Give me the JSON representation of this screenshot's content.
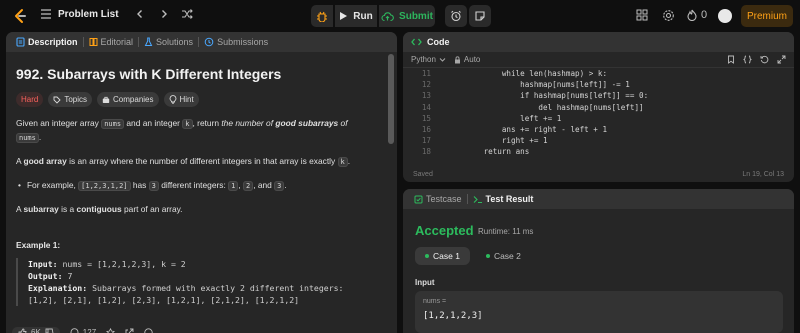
{
  "topbar": {
    "problem_list": "Problem List",
    "run": "Run",
    "submit": "Submit",
    "streak_count": "0",
    "premium": "Premium"
  },
  "left": {
    "tabs": [
      "Description",
      "Editorial",
      "Solutions",
      "Submissions"
    ],
    "title": "992. Subarrays with K Different Integers",
    "tags": [
      "Hard",
      "Topics",
      "Companies",
      "Hint"
    ],
    "desc1_a": "Given an integer array ",
    "desc1_nums": "nums",
    "desc1_b": " and an integer ",
    "desc1_k": "k",
    "desc1_c": ", return ",
    "desc1_d": "the number of ",
    "desc1_e": "good subarrays",
    "desc1_f": " of",
    "desc1_nums2": "nums",
    "desc1_g": ".",
    "desc2_a": "A ",
    "desc2_b": "good array",
    "desc2_c": " is an array where the number of different integers in that array is exactly ",
    "desc2_k": "k",
    "desc2_d": ".",
    "bullet_a": "For example, ",
    "bullet_code": "[1,2,3,1,2]",
    "bullet_b": " has ",
    "bullet_3": "3",
    "bullet_c": " different integers: ",
    "bullet_1": "1",
    "bullet_d": ", ",
    "bullet_2": "2",
    "bullet_e": ", and ",
    "bullet_3b": "3",
    "bullet_f": ".",
    "desc3_a": "A ",
    "desc3_b": "subarray",
    "desc3_c": " is a ",
    "desc3_d": "contiguous",
    "desc3_e": " part of an array.",
    "example_title": "Example 1:",
    "ex_input_label": "Input:",
    "ex_input": " nums = [1,2,1,2,3], k = 2",
    "ex_output_label": "Output:",
    "ex_output": " 7",
    "ex_expl_label": "Explanation:",
    "ex_expl": " Subarrays formed with exactly 2 different integers:",
    "ex_expl2": "[1,2], [2,1], [1,2], [2,3], [1,2,1], [2,1,2], [1,2,1,2]",
    "likes": "6K",
    "comments": "127"
  },
  "code": {
    "header": "Code",
    "language": "Python",
    "mode": "Auto",
    "lines": [
      {
        "n": "11",
        "t": "            while len(hashmap) > k:"
      },
      {
        "n": "12",
        "t": "                hashmap[nums[left]] -= 1"
      },
      {
        "n": "13",
        "t": "                if hashmap[nums[left]] == 0:"
      },
      {
        "n": "14",
        "t": "                    del hashmap[nums[left]]"
      },
      {
        "n": "15",
        "t": "                left += 1"
      },
      {
        "n": "16",
        "t": "            ans += right - left + 1"
      },
      {
        "n": "17",
        "t": "            right += 1"
      },
      {
        "n": "18",
        "t": "        return ans"
      }
    ],
    "saved": "Saved",
    "cursor": "Ln 19, Col 13"
  },
  "result": {
    "tabs": [
      "Testcase",
      "Test Result"
    ],
    "status": "Accepted",
    "runtime": "Runtime: 11 ms",
    "cases": [
      "Case 1",
      "Case 2"
    ],
    "input_label": "Input",
    "input_name": "nums =",
    "input_value": "[1,2,1,2,3]"
  },
  "colors": {
    "accent": "#ffa116",
    "accepted": "#2cbb5d",
    "hard": "#f8615c"
  }
}
